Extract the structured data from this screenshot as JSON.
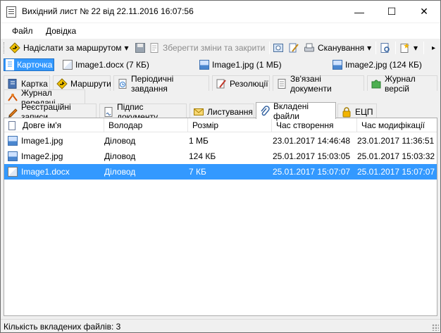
{
  "window": {
    "title": "Вихідний лист № 22 від 22.11.2016 16:07:56",
    "minimize": "—",
    "maximize": "☐",
    "close": "✕"
  },
  "menu": {
    "file": "Файл",
    "help": "Довідка"
  },
  "toolbar": {
    "send_route": "Надіслати за маршрутом",
    "save_close": "Зберегти зміни та закрити",
    "scan": "Сканування",
    "dropdown_arrow": "▾",
    "overflow": "▸"
  },
  "open_items": [
    {
      "label": "Карточка"
    },
    {
      "label": "Image1.docx (7 КБ)"
    },
    {
      "label": "Image1.jpg (1 МБ)"
    },
    {
      "label": "Image2.jpg (124 КБ)"
    }
  ],
  "tabs_row1": [
    "Картка",
    "Маршрути",
    "Періодичні завдання",
    "Резолюції",
    "Зв'язані документи",
    "Журнал версій"
  ],
  "tabs_row2": [
    "Журнал передачі"
  ],
  "tabs_row3": [
    "Реєстраційні записи",
    "Підпис документу",
    "Листування",
    "Вкладені файли",
    "ЕЦП"
  ],
  "table": {
    "headers": [
      "Довге ім'я",
      "Володар",
      "Розмір",
      "Час створення",
      "Час модифікації"
    ],
    "rows": [
      [
        "Image1.jpg",
        "Діловод",
        "1 МБ",
        "23.01.2017 14:46:48",
        "23.01.2017 11:36:51"
      ],
      [
        "Image2.jpg",
        "Діловод",
        "124 КБ",
        "25.01.2017 15:03:05",
        "25.01.2017 15:03:32"
      ],
      [
        "Image1.docx",
        "Діловод",
        "7 КБ",
        "25.01.2017 15:07:07",
        "25.01.2017 15:07:07"
      ]
    ]
  },
  "status": {
    "text": "Кількість вкладених файлів: 3"
  },
  "colors": {
    "selection": "#3399ff",
    "window_bg": "#f0f0f0"
  }
}
